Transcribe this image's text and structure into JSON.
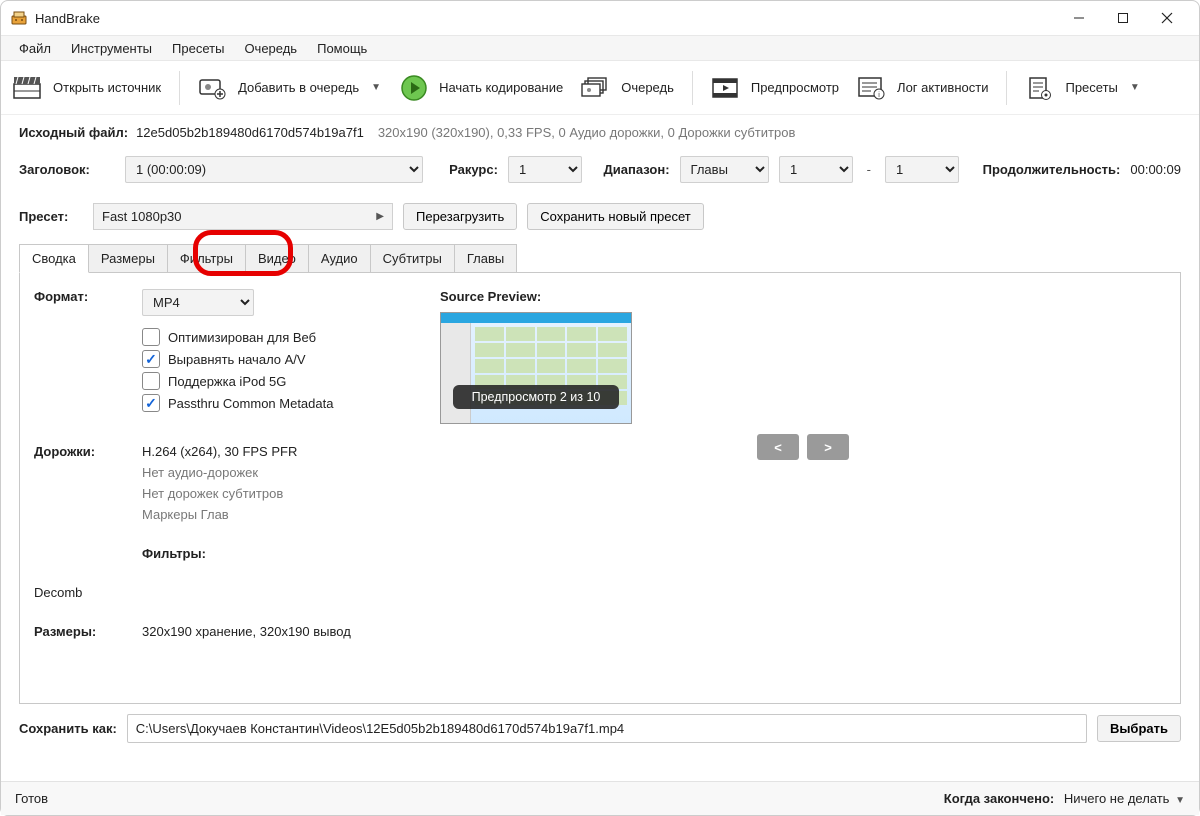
{
  "window": {
    "title": "HandBrake"
  },
  "menu": [
    "Файл",
    "Инструменты",
    "Пресеты",
    "Очередь",
    "Помощь"
  ],
  "toolbar": {
    "open": "Открыть источник",
    "add_queue": "Добавить в очередь",
    "start": "Начать кодирование",
    "queue": "Очередь",
    "preview": "Предпросмотр",
    "activity": "Лог активности",
    "presets": "Пресеты"
  },
  "source": {
    "label": "Исходный файл:",
    "name": "12e5d05b2b189480d6170d574b19a7f1",
    "info": "320x190 (320x190), 0,33 FPS, 0 Аудио дорожки, 0 Дорожки субтитров"
  },
  "title_row": {
    "label": "Заголовок:",
    "value": "1  (00:00:09)",
    "angle_label": "Ракурс:",
    "angle_value": "1",
    "range_label": "Диапазон:",
    "range_type": "Главы",
    "range_start": "1",
    "range_end": "1",
    "duration_label": "Продолжительность:",
    "duration": "00:00:09"
  },
  "preset_row": {
    "label": "Пресет:",
    "value": "Fast 1080p30",
    "reload": "Перезагрузить",
    "save_new": "Сохранить новый пресет"
  },
  "tabs": [
    "Сводка",
    "Размеры",
    "Фильтры",
    "Видео",
    "Аудио",
    "Субтитры",
    "Главы"
  ],
  "summary": {
    "format_label": "Формат:",
    "format_value": "MP4",
    "checks": {
      "web": {
        "label": "Оптимизирован для Веб",
        "checked": false
      },
      "align": {
        "label": "Выравнять начало A/V",
        "checked": true
      },
      "ipod": {
        "label": "Поддержка iPod 5G",
        "checked": false
      },
      "passthru": {
        "label": "Passthru Common Metadata",
        "checked": true
      }
    },
    "tracks_label": "Дорожки:",
    "tracks": [
      "H.264 (x264), 30 FPS PFR",
      "Нет аудио-дорожек",
      "Нет дорожек субтитров",
      "Маркеры Глав"
    ],
    "filters_label": "Фильтры:",
    "filters_value": "Decomb",
    "size_label": "Размеры:",
    "size_value": "320x190 хранение, 320x190 вывод"
  },
  "preview": {
    "title": "Source Preview:",
    "overlay": "Предпросмотр 2 из 10",
    "prev": "<",
    "next": ">"
  },
  "save": {
    "label": "Сохранить как:",
    "path": "C:\\Users\\Докучаев Константин\\Videos\\12E5d05b2b189480d6170d574b19a7f1.mp4",
    "browse": "Выбрать"
  },
  "status": {
    "ready": "Готов",
    "done_label": "Когда закончено:",
    "done_value": "Ничего не делать"
  }
}
